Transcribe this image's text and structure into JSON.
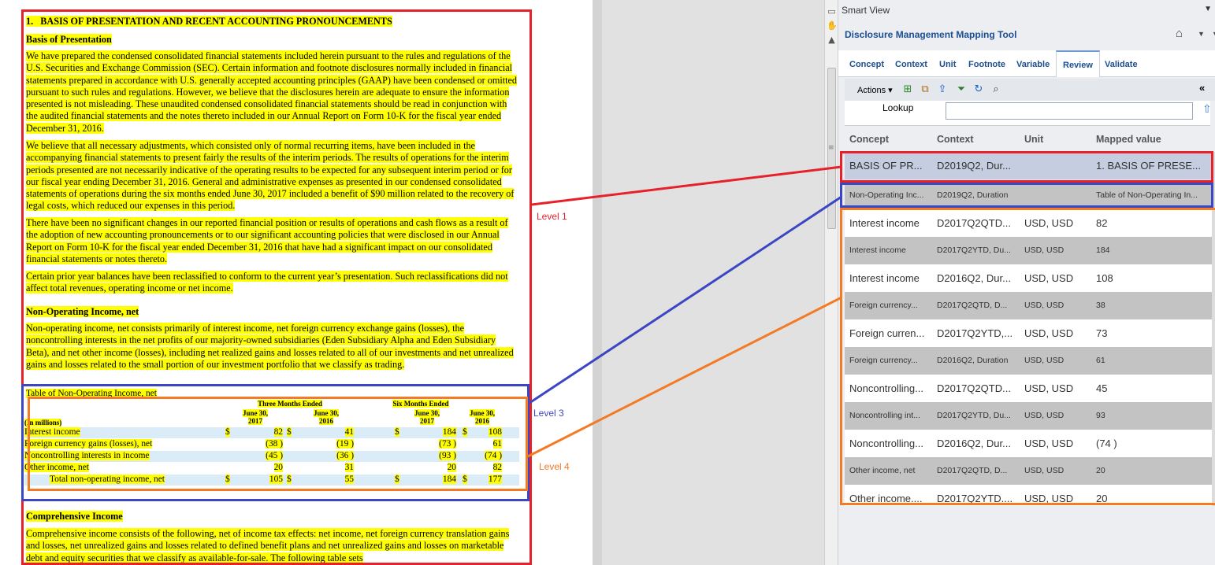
{
  "document": {
    "section_title": "1.   BASIS OF PRESENTATION AND RECENT ACCOUNTING PRONOUNCEMENTS",
    "basis_heading": "Basis of Presentation",
    "para1": "We have prepared the condensed consolidated financial statements included herein pursuant to the rules and regulations of the U.S. Securities and Exchange Commission (SEC). Certain information and footnote disclosures normally included in financial statements prepared in accordance with U.S. generally accepted accounting principles (GAAP) have been condensed or omitted pursuant to such rules and regulations. However, we believe that the disclosures herein are adequate to ensure the information presented is not misleading. These unaudited condensed consolidated financial statements should be read in conjunction with the audited financial statements and the notes thereto included in our Annual Report on Form 10-K for the fiscal year ended December 31, 2016.",
    "para2": "We believe that all necessary adjustments, which consisted only of normal recurring items, have been included in the accompanying financial statements to present fairly the results of the interim periods. The results of operations for the interim periods presented are not necessarily indicative of the operating results to be expected for any subsequent interim period or for our fiscal year ending December 31, 2016. General and administrative expenses as presented in our condensed consolidated statements of operations during the six months ended June 30, 2017 included a benefit of $90 million related to the recovery of legal costs, which reduced our expenses in this period.",
    "para3": "There have been no significant changes in our reported financial position or results of operations and cash flows as a result of the adoption of new accounting pronouncements or to our significant accounting policies that were disclosed in our Annual Report on Form 10-K for the fiscal year ended December 31, 2016 that have had a significant impact on our consolidated financial statements or notes thereto.",
    "para4": "Certain prior year balances have been reclassified to conform to the current year’s presentation. Such reclassifications did not affect total revenues, operating income or net income.",
    "nonop_heading": "Non-Operating Income, net",
    "para5": "Non-operating income, net consists primarily of interest income, net foreign currency exchange gains (losses), the noncontrolling interests in the net profits of our majority-owned subsidiaries (Eden Subsidiary Alpha and Eden Subsidiary Beta), and net other income (losses), including net realized gains and losses related to all of our investments and net unrealized gains and losses related to the small portion of our investment portfolio that we classify as trading.",
    "table": {
      "caption": "Table of Non-Operating Income, net",
      "group1": "Three Months Ended",
      "group2": "Six Months Ended",
      "col1": "June 30, 2017",
      "col2": "June 30, 2016",
      "col3": "June 30, 2017",
      "col4": "June 30, 2016",
      "units": "(In millions)",
      "rows": [
        {
          "label": "Interest income",
          "v1": "82",
          "v2": "41",
          "v3": "184",
          "v4": "108",
          "dollar": "$"
        },
        {
          "label": "Foreign currency gains (losses), net",
          "v1": "(38 )",
          "v2": "(19 )",
          "v3": "(73 )",
          "v4": "61",
          "dollar": ""
        },
        {
          "label": "Noncontrolling interests in income",
          "v1": "(45 )",
          "v2": "(36 )",
          "v3": "(93 )",
          "v4": "(74 )",
          "dollar": ""
        },
        {
          "label": "Other income, net",
          "v1": "20",
          "v2": "31",
          "v3": "20",
          "v4": "82",
          "dollar": ""
        },
        {
          "label": "Total non-operating income, net",
          "v1": "105",
          "v2": "55",
          "v3": "184",
          "v4": "177",
          "dollar": "$"
        }
      ]
    },
    "comp_heading": "Comprehensive Income",
    "para6": "Comprehensive income consists of the following, net of income tax effects: net income, net foreign currency translation gains and losses, net unrealized gains and losses related to defined benefit plans and net unrealized gains and losses on marketable debt and equity securities that we classify as available-for-sale. The following table sets"
  },
  "annotations": {
    "level1": "Level 1",
    "level3": "Level 3",
    "level4": "Level 4",
    "color_level1": "#e8202a",
    "color_level3": "#3b46c4",
    "color_level4": "#f47a23"
  },
  "pane": {
    "title": "Smart View",
    "tool_title": "Disclosure Management Mapping Tool",
    "tabs": [
      "Concept",
      "Context",
      "Unit",
      "Footnote",
      "Variable",
      "Review",
      "Validate"
    ],
    "active_tab": "Review",
    "actions_label": "Actions",
    "lookup_label": "Lookup",
    "lookup_value": "",
    "columns": [
      "Concept",
      "Context",
      "Unit",
      "Mapped value"
    ],
    "rows": [
      {
        "concept": "BASIS OF PR...",
        "context": "D2019Q2, Dur...",
        "unit": "",
        "value": "1. BASIS OF PRESE..."
      },
      {
        "concept": "Non-Operating Inc...",
        "context": "D2019Q2, Duration",
        "unit": "",
        "value": "Table of Non-Operating In..."
      },
      {
        "concept": "Interest income",
        "context": "D2017Q2QTD...",
        "unit": "USD, USD",
        "value": "82"
      },
      {
        "concept": "Interest income",
        "context": "D2017Q2YTD, Du...",
        "unit": "USD, USD",
        "value": "184"
      },
      {
        "concept": "Interest income",
        "context": "D2016Q2, Dur...",
        "unit": "USD, USD",
        "value": "108"
      },
      {
        "concept": "Foreign currency...",
        "context": "D2017Q2QTD, D...",
        "unit": "USD, USD",
        "value": "38"
      },
      {
        "concept": "Foreign curren...",
        "context": "D2017Q2YTD,...",
        "unit": "USD, USD",
        "value": "73"
      },
      {
        "concept": "Foreign currency...",
        "context": "D2016Q2, Duration",
        "unit": "USD, USD",
        "value": "61"
      },
      {
        "concept": "Noncontrolling...",
        "context": "D2017Q2QTD...",
        "unit": "USD, USD",
        "value": "45"
      },
      {
        "concept": "Noncontrolling int...",
        "context": "D2017Q2YTD, Du...",
        "unit": "USD, USD",
        "value": "93"
      },
      {
        "concept": "Noncontrolling...",
        "context": "D2016Q2, Dur...",
        "unit": "USD, USD",
        "value": "(74 )"
      },
      {
        "concept": "Other income, net",
        "context": "D2017Q2QTD, D...",
        "unit": "USD, USD",
        "value": "20"
      },
      {
        "concept": "Other income....",
        "context": "D2017Q2YTD....",
        "unit": "USD, USD",
        "value": "20"
      }
    ]
  }
}
